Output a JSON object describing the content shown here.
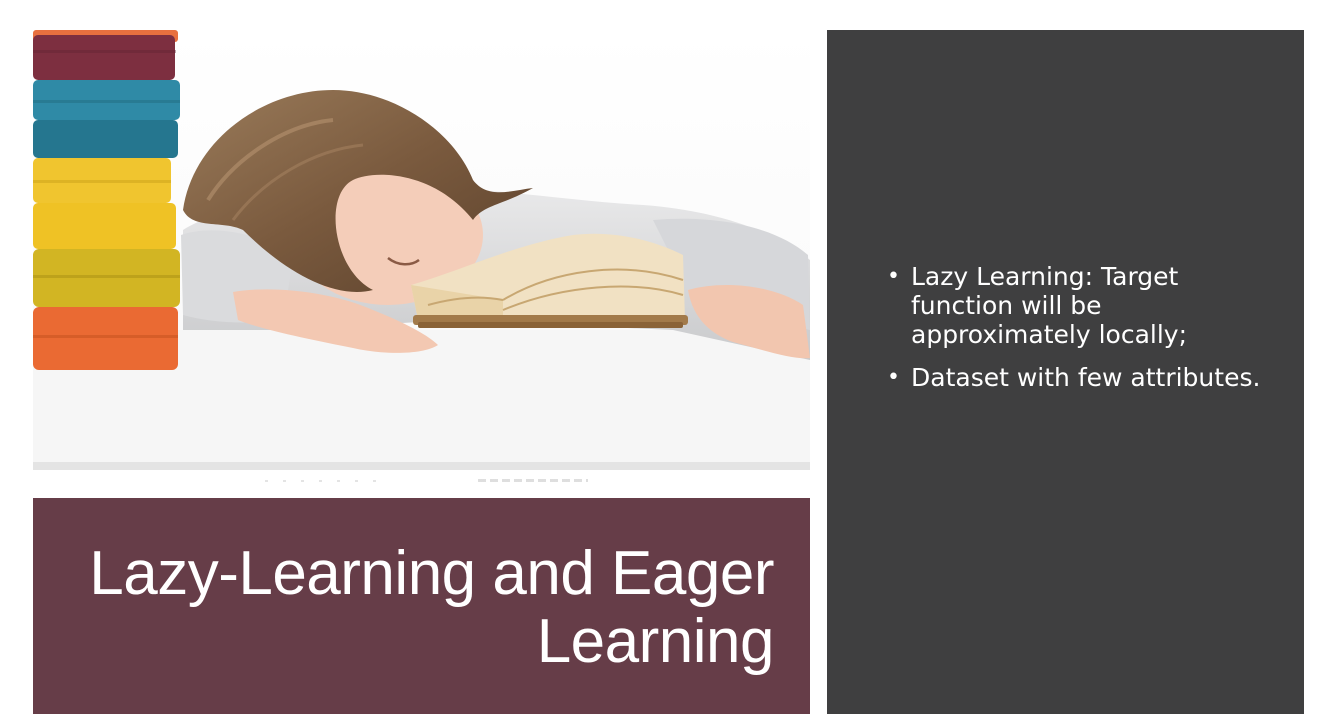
{
  "slide": {
    "title": "Lazy-Learning and Eager Learning",
    "bullets": [
      "Lazy Learning: Target function will be approximately locally;",
      "Dataset with few attributes."
    ],
    "bullet_glyph": "•",
    "image": {
      "icon": "girl-sleeping-on-book-photo"
    }
  },
  "colors": {
    "title_block": "#663d48",
    "right_panel": "#3f3f40",
    "text": "#ffffff",
    "background": "#ffffff"
  }
}
